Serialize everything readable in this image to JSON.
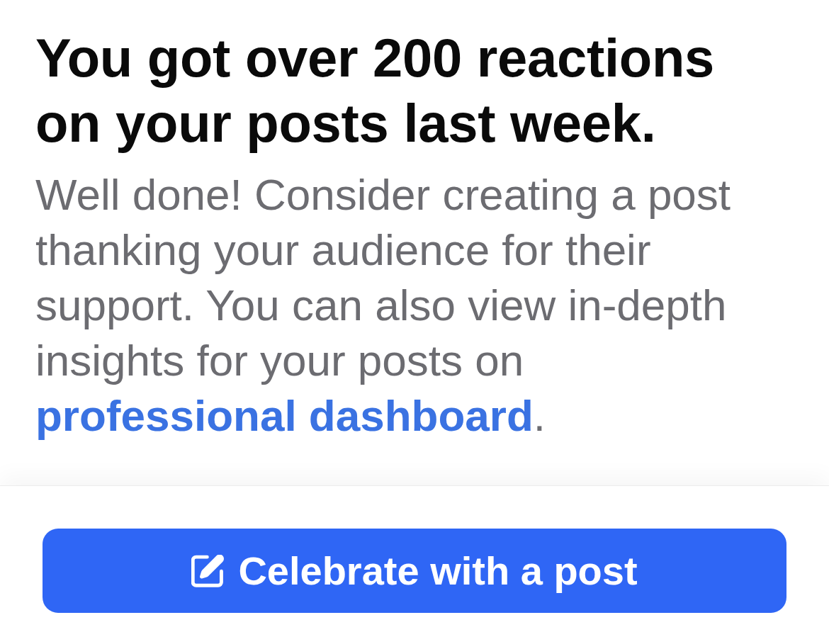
{
  "heading": "You got over 200 reactions on your posts last week.",
  "body": {
    "text": "Well done! Consider creating a post thanking your audience for their support. You can also view in-depth insights for your posts on ",
    "link": "professional dashboard",
    "end": "."
  },
  "button": {
    "label": "Celebrate with a post"
  }
}
